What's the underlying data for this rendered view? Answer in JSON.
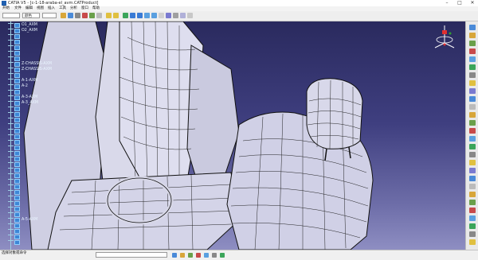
{
  "window": {
    "title": "CATIA V5 - [c-1-18-araba-el_avm.CATProduct]",
    "controls": [
      "–",
      "□",
      "✕"
    ]
  },
  "menu": {
    "items": [
      "开始",
      "文件",
      "编辑",
      "视图",
      "插入",
      "工具",
      "分析",
      "窗口",
      "帮助"
    ]
  },
  "toolbar": {
    "select_primary": "",
    "select_secondary": "颜色",
    "select_third": ""
  },
  "tree": {
    "nodes": [
      {
        "label": "O1_AXM"
      },
      {
        "label": "O2_AXM"
      },
      {
        "label": ""
      },
      {
        "label": ""
      },
      {
        "label": ""
      },
      {
        "label": ""
      },
      {
        "label": ""
      },
      {
        "label": "Z-CHASSIS-AXM"
      },
      {
        "label": "Z-CHASSIS-AXM"
      },
      {
        "label": ""
      },
      {
        "label": "A-1-AXM"
      },
      {
        "label": "A-2"
      },
      {
        "label": ""
      },
      {
        "label": "A-3-AXM"
      },
      {
        "label": "A-3_AXM"
      },
      {
        "label": ""
      },
      {
        "label": ""
      },
      {
        "label": ""
      },
      {
        "label": ""
      },
      {
        "label": ""
      },
      {
        "label": ""
      },
      {
        "label": ""
      },
      {
        "label": ""
      },
      {
        "label": ""
      },
      {
        "label": ""
      },
      {
        "label": ""
      },
      {
        "label": ""
      },
      {
        "label": ""
      },
      {
        "label": ""
      },
      {
        "label": ""
      },
      {
        "label": ""
      },
      {
        "label": ""
      },
      {
        "label": ""
      },
      {
        "label": ""
      },
      {
        "label": ""
      },
      {
        "label": "A-5-AXM"
      },
      {
        "label": ""
      },
      {
        "label": ""
      },
      {
        "label": ""
      },
      {
        "label": ""
      }
    ]
  },
  "status": {
    "text": "选择对象或命令"
  },
  "colors": {
    "viewport_top": "#2a2a5e",
    "viewport_bottom": "#8e8ec2",
    "tree_text": "#e9f4ff",
    "tree_line": "#9ecfe4",
    "toolbar_bg": "#eeeeee",
    "accent": "#1f5fb0"
  }
}
